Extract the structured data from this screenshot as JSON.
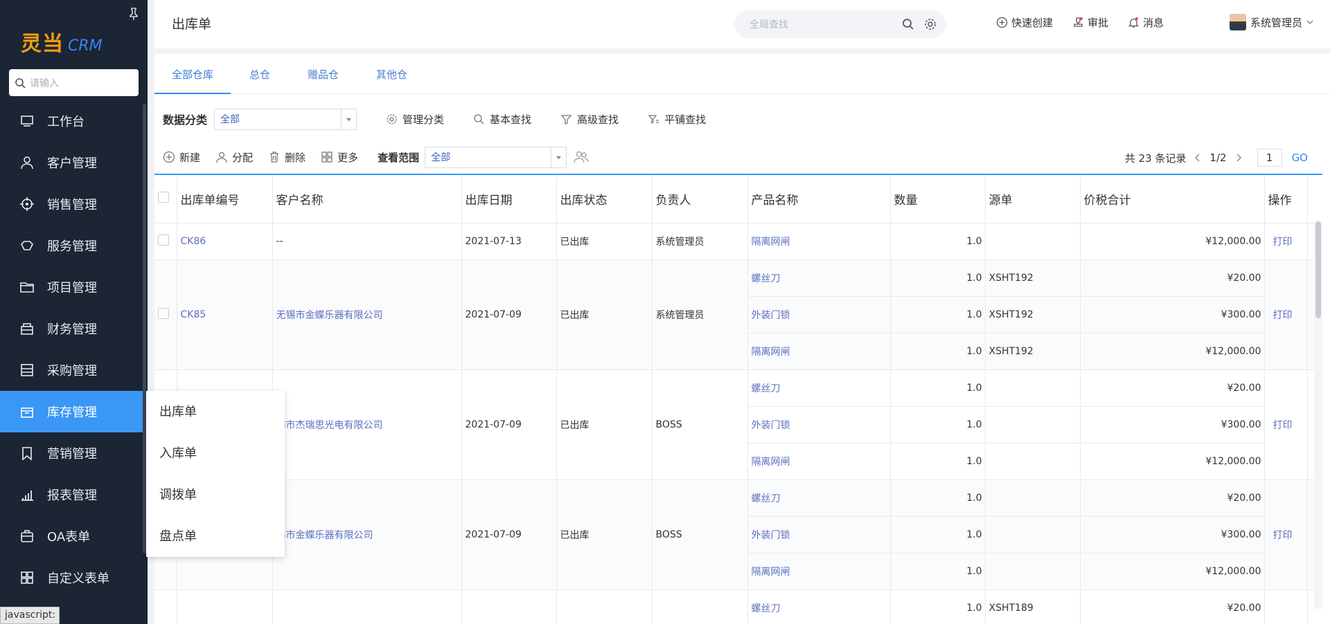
{
  "app": {
    "logo_cn": "灵当",
    "logo_en": "CRM"
  },
  "sidebar": {
    "search_placeholder": "请输入",
    "items": [
      {
        "label": "工作台",
        "icon": "monitor-icon"
      },
      {
        "label": "客户管理",
        "icon": "person-icon"
      },
      {
        "label": "销售管理",
        "icon": "target-icon"
      },
      {
        "label": "服务管理",
        "icon": "service-icon"
      },
      {
        "label": "项目管理",
        "icon": "folder-icon"
      },
      {
        "label": "财务管理",
        "icon": "finance-icon"
      },
      {
        "label": "采购管理",
        "icon": "purchase-icon"
      },
      {
        "label": "库存管理",
        "icon": "inventory-icon",
        "active": true
      },
      {
        "label": "营销管理",
        "icon": "bookmark-icon"
      },
      {
        "label": "报表管理",
        "icon": "bar-chart-icon"
      },
      {
        "label": "OA表单",
        "icon": "briefcase-icon"
      },
      {
        "label": "自定义表单",
        "icon": "grid-icon"
      }
    ],
    "flyout": [
      "出库单",
      "入库单",
      "调拨单",
      "盘点单"
    ]
  },
  "status_bar": "javascript:",
  "topbar": {
    "title": "出库单",
    "search_placeholder": "全局查找",
    "actions": [
      "快速创建",
      "审批",
      "消息"
    ],
    "user": "系统管理员"
  },
  "tabs": [
    "全部仓库",
    "总仓",
    "赠品仓",
    "其他仓"
  ],
  "filter": {
    "label": "数据分类",
    "select_value": "全部",
    "buttons": [
      "管理分类",
      "基本查找",
      "高级查找",
      "平铺查找"
    ]
  },
  "toolbar": {
    "buttons": [
      "新建",
      "分配",
      "删除",
      "更多"
    ],
    "scope_label": "查看范围",
    "scope_value": "全部",
    "record_count": "共 23 条记录",
    "page_info": "1/2",
    "page_input": "1",
    "go": "GO"
  },
  "table": {
    "columns": [
      "出库单编号",
      "客户名称",
      "出库日期",
      "出库状态",
      "负责人",
      "产品名称",
      "数量",
      "源单",
      "价税合计",
      "操作"
    ],
    "op_label": "打印",
    "rows": [
      {
        "id": "CK86",
        "customer": "--",
        "date": "2021-07-13",
        "status": "已出库",
        "owner": "系统管理员",
        "items": [
          {
            "product": "隔离网闸",
            "qty": "1.0",
            "source": "",
            "total": "¥12,000.00"
          }
        ]
      },
      {
        "id": "CK85",
        "customer": "无锡市金蝶乐器有限公司",
        "date": "2021-07-09",
        "status": "已出库",
        "owner": "系统管理员",
        "items": [
          {
            "product": "螺丝刀",
            "qty": "1.0",
            "source": "XSHT192",
            "total": "¥20.00"
          },
          {
            "product": "外装门锁",
            "qty": "1.0",
            "source": "XSHT192",
            "total": "¥300.00"
          },
          {
            "product": "隔离网闸",
            "qty": "1.0",
            "source": "XSHT192",
            "total": "¥12,000.00"
          }
        ]
      },
      {
        "id": "",
        "customer": "圳市杰瑞思光电有限公司",
        "date": "2021-07-09",
        "status": "已出库",
        "owner": "BOSS",
        "items": [
          {
            "product": "螺丝刀",
            "qty": "1.0",
            "source": "",
            "total": "¥20.00"
          },
          {
            "product": "外装门锁",
            "qty": "1.0",
            "source": "",
            "total": "¥300.00"
          },
          {
            "product": "隔离网闸",
            "qty": "1.0",
            "source": "",
            "total": "¥12,000.00"
          }
        ]
      },
      {
        "id": "",
        "customer": "锡市金蝶乐器有限公司",
        "date": "2021-07-09",
        "status": "已出库",
        "owner": "BOSS",
        "items": [
          {
            "product": "螺丝刀",
            "qty": "1.0",
            "source": "",
            "total": "¥20.00"
          },
          {
            "product": "外装门锁",
            "qty": "1.0",
            "source": "",
            "total": "¥300.00"
          },
          {
            "product": "隔离网闸",
            "qty": "1.0",
            "source": "",
            "total": "¥12,000.00"
          }
        ]
      },
      {
        "id": "",
        "customer": "",
        "date": "",
        "status": "",
        "owner": "",
        "items": [
          {
            "product": "螺丝刀",
            "qty": "1.0",
            "source": "XSHT189",
            "total": "¥20.00"
          }
        ]
      }
    ]
  }
}
